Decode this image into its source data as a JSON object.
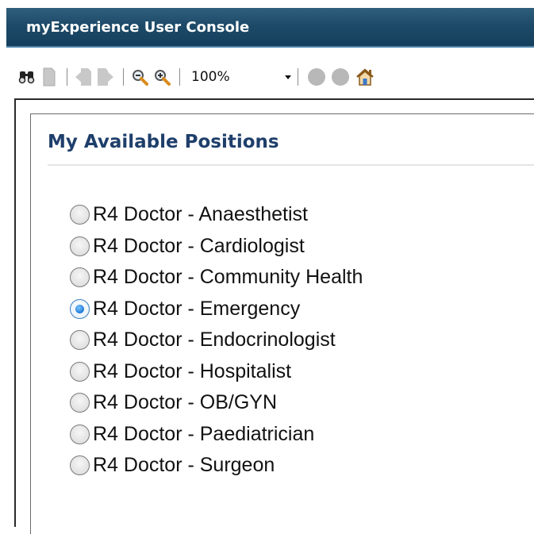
{
  "window": {
    "title": "myExperience User Console"
  },
  "toolbar": {
    "buttons": [
      {
        "name": "find-icon"
      },
      {
        "name": "page-icon"
      },
      {
        "name": "first-page-icon"
      },
      {
        "name": "next-page-icon"
      },
      {
        "name": "zoom-out-icon"
      },
      {
        "name": "zoom-in-icon"
      }
    ],
    "zoom_value": "100%",
    "status_buttons": [
      "circle-button-1",
      "circle-button-2"
    ],
    "home_icon": "home-icon"
  },
  "main": {
    "heading": "My Available Positions",
    "positions": [
      {
        "label": "R4 Doctor - Anaesthetist",
        "selected": false
      },
      {
        "label": "R4 Doctor - Cardiologist",
        "selected": false
      },
      {
        "label": "R4 Doctor - Community Health",
        "selected": false
      },
      {
        "label": "R4 Doctor - Emergency",
        "selected": true
      },
      {
        "label": "R4 Doctor - Endocrinologist",
        "selected": false
      },
      {
        "label": "R4 Doctor - Hospitalist",
        "selected": false
      },
      {
        "label": "R4 Doctor - OB/GYN",
        "selected": false
      },
      {
        "label": "R4 Doctor - Paediatrician",
        "selected": false
      },
      {
        "label": "R4 Doctor - Surgeon",
        "selected": false
      }
    ]
  },
  "colors": {
    "title_bar": "#1d4a68",
    "heading_text": "#1f3f6b",
    "radio_selected": "#1f7ad6"
  }
}
